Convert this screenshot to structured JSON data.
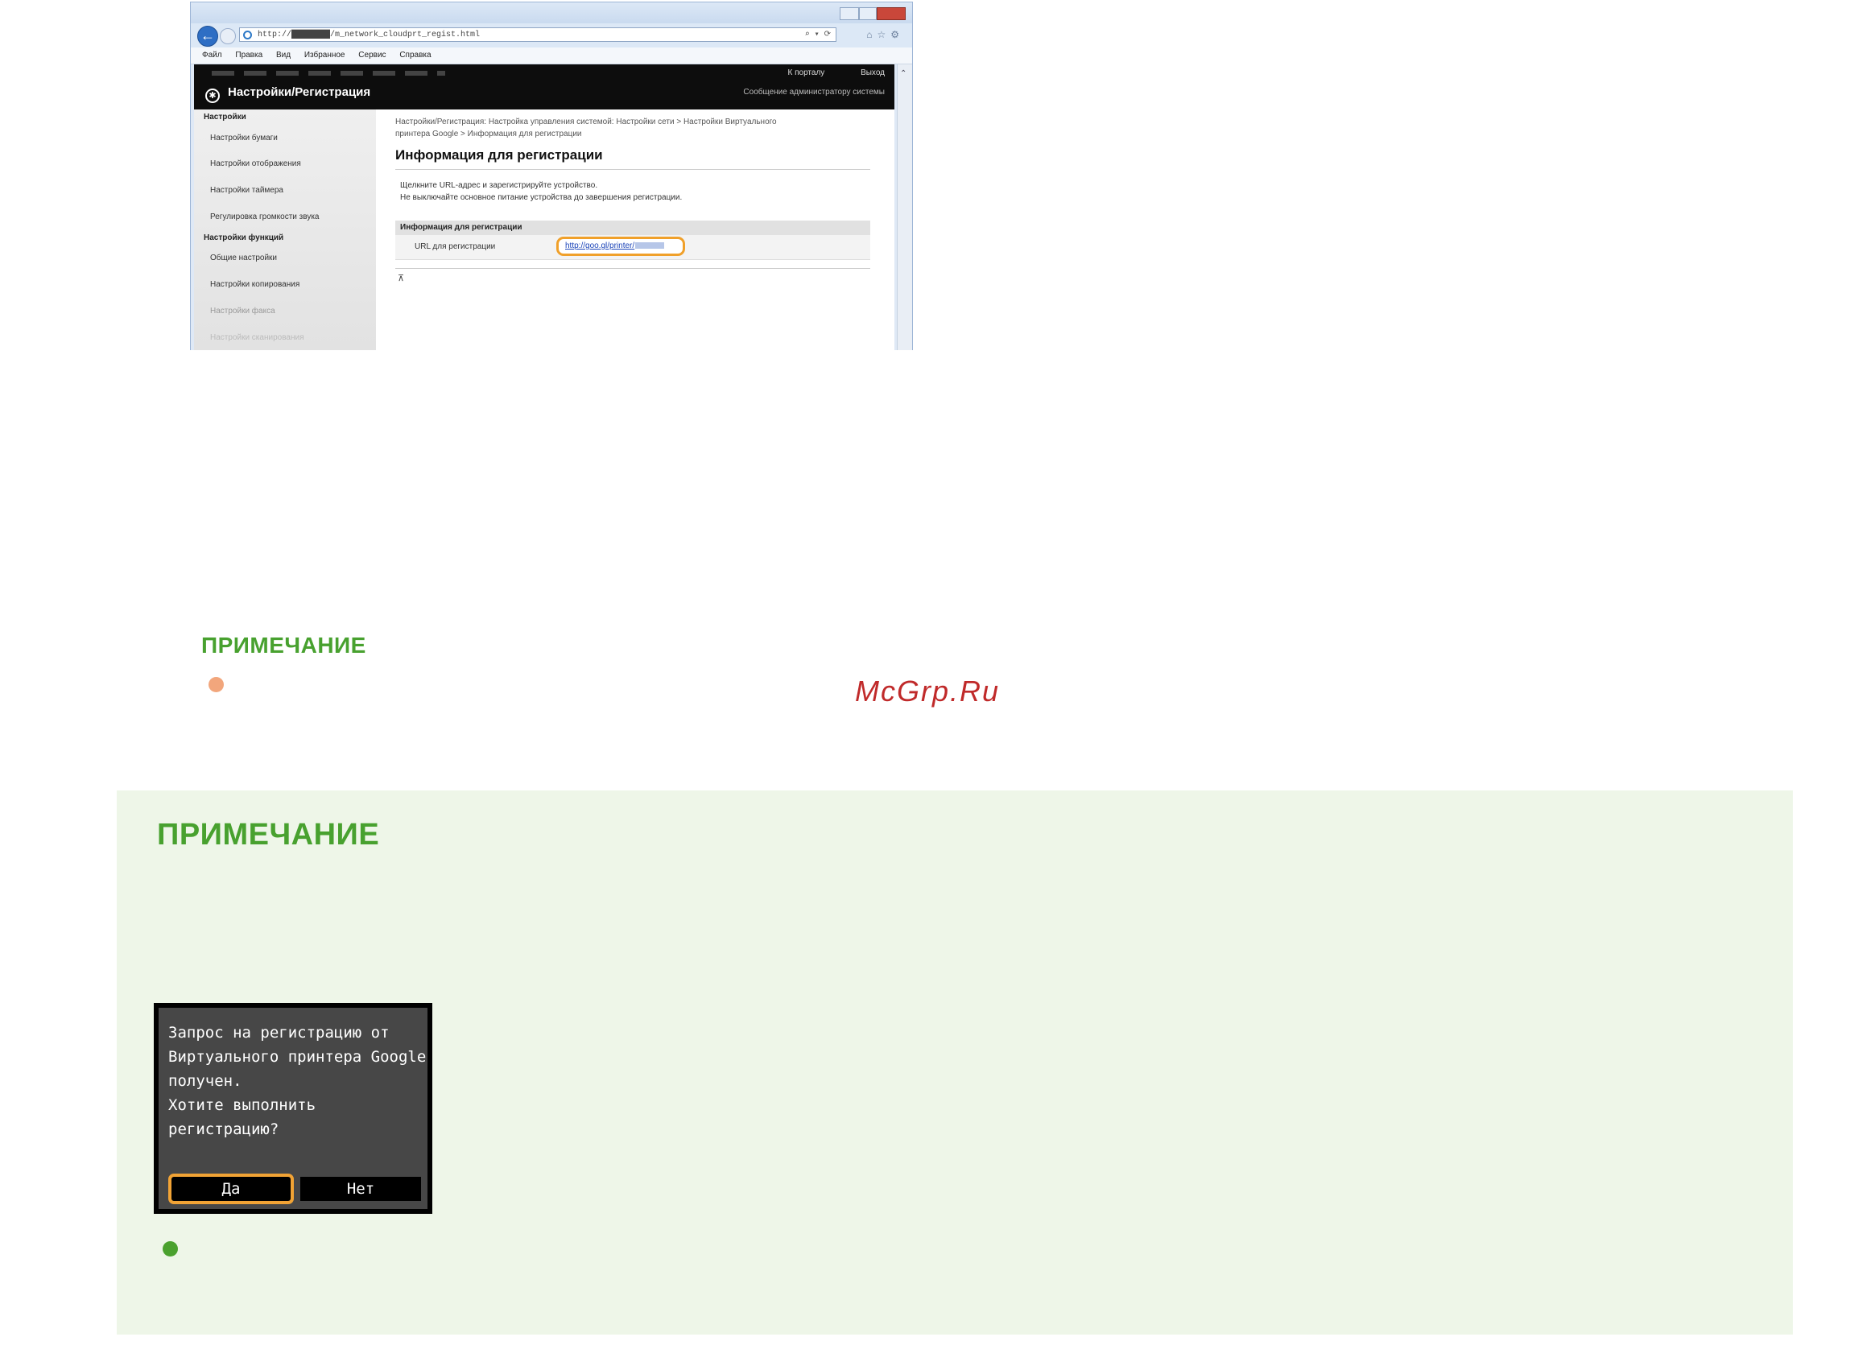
{
  "browser": {
    "address_url": "http://████████/m_network_cloudprt_regist.html",
    "address_tools": "⌕ ▾ ⟳",
    "toolbar_icons": "⌂☆⚙",
    "menu": [
      "Файл",
      "Правка",
      "Вид",
      "Избранное",
      "Сервис",
      "Справка"
    ]
  },
  "webui": {
    "top_links": [
      "К порталу",
      "Выход"
    ],
    "admin_message": "Сообщение администратору системы",
    "brand": "Настройки/Регистрация",
    "sidebar": {
      "category1": "Настройки",
      "items1": [
        "Настройки бумаги",
        "Настройки отображения",
        "Настройки таймера",
        "Регулировка громкости звука"
      ],
      "category2": "Настройки функций",
      "items2": [
        "Общие настройки",
        "Настройки копирования",
        "Настройки факса",
        "Настройки сканирования"
      ]
    },
    "breadcrumb_line1": "Настройки/Регистрация: Настройка управления системой: Настройки сети > Настройки Виртуального",
    "breadcrumb_line2": "принтера Google > Информация для регистрации",
    "heading": "Информация для регистрации",
    "desc_line1": "Щелкните URL-адрес и зарегистрируйте устройство.",
    "desc_line2": "Не выключайте основное питание устройства до завершения регистрации.",
    "table_header": "Информация для регистрации",
    "row_label": "URL для регистрации",
    "row_url": "http://goo.gl/printer/",
    "page_top_icon": "⊼"
  },
  "note1_title": "ПРИМЕЧАНИЕ",
  "watermark": "McGrp.Ru",
  "note2": {
    "title": "ПРИМЕЧАНИЕ",
    "lcd_message": "Запрос на регистрацию от\nВиртуального принтера Google\nполучен.\nХотите выполнить\nрегистрацию?",
    "yes_button": "Да",
    "no_button": "Нет"
  },
  "colors": {
    "note_title": "#48a12f",
    "note_box_bg": "#eef6e8",
    "highlight": "#f0a02a",
    "bullet_orange": "#f2a67c",
    "bullet_green": "#4aa12e",
    "watermark": "#c02a2a"
  }
}
